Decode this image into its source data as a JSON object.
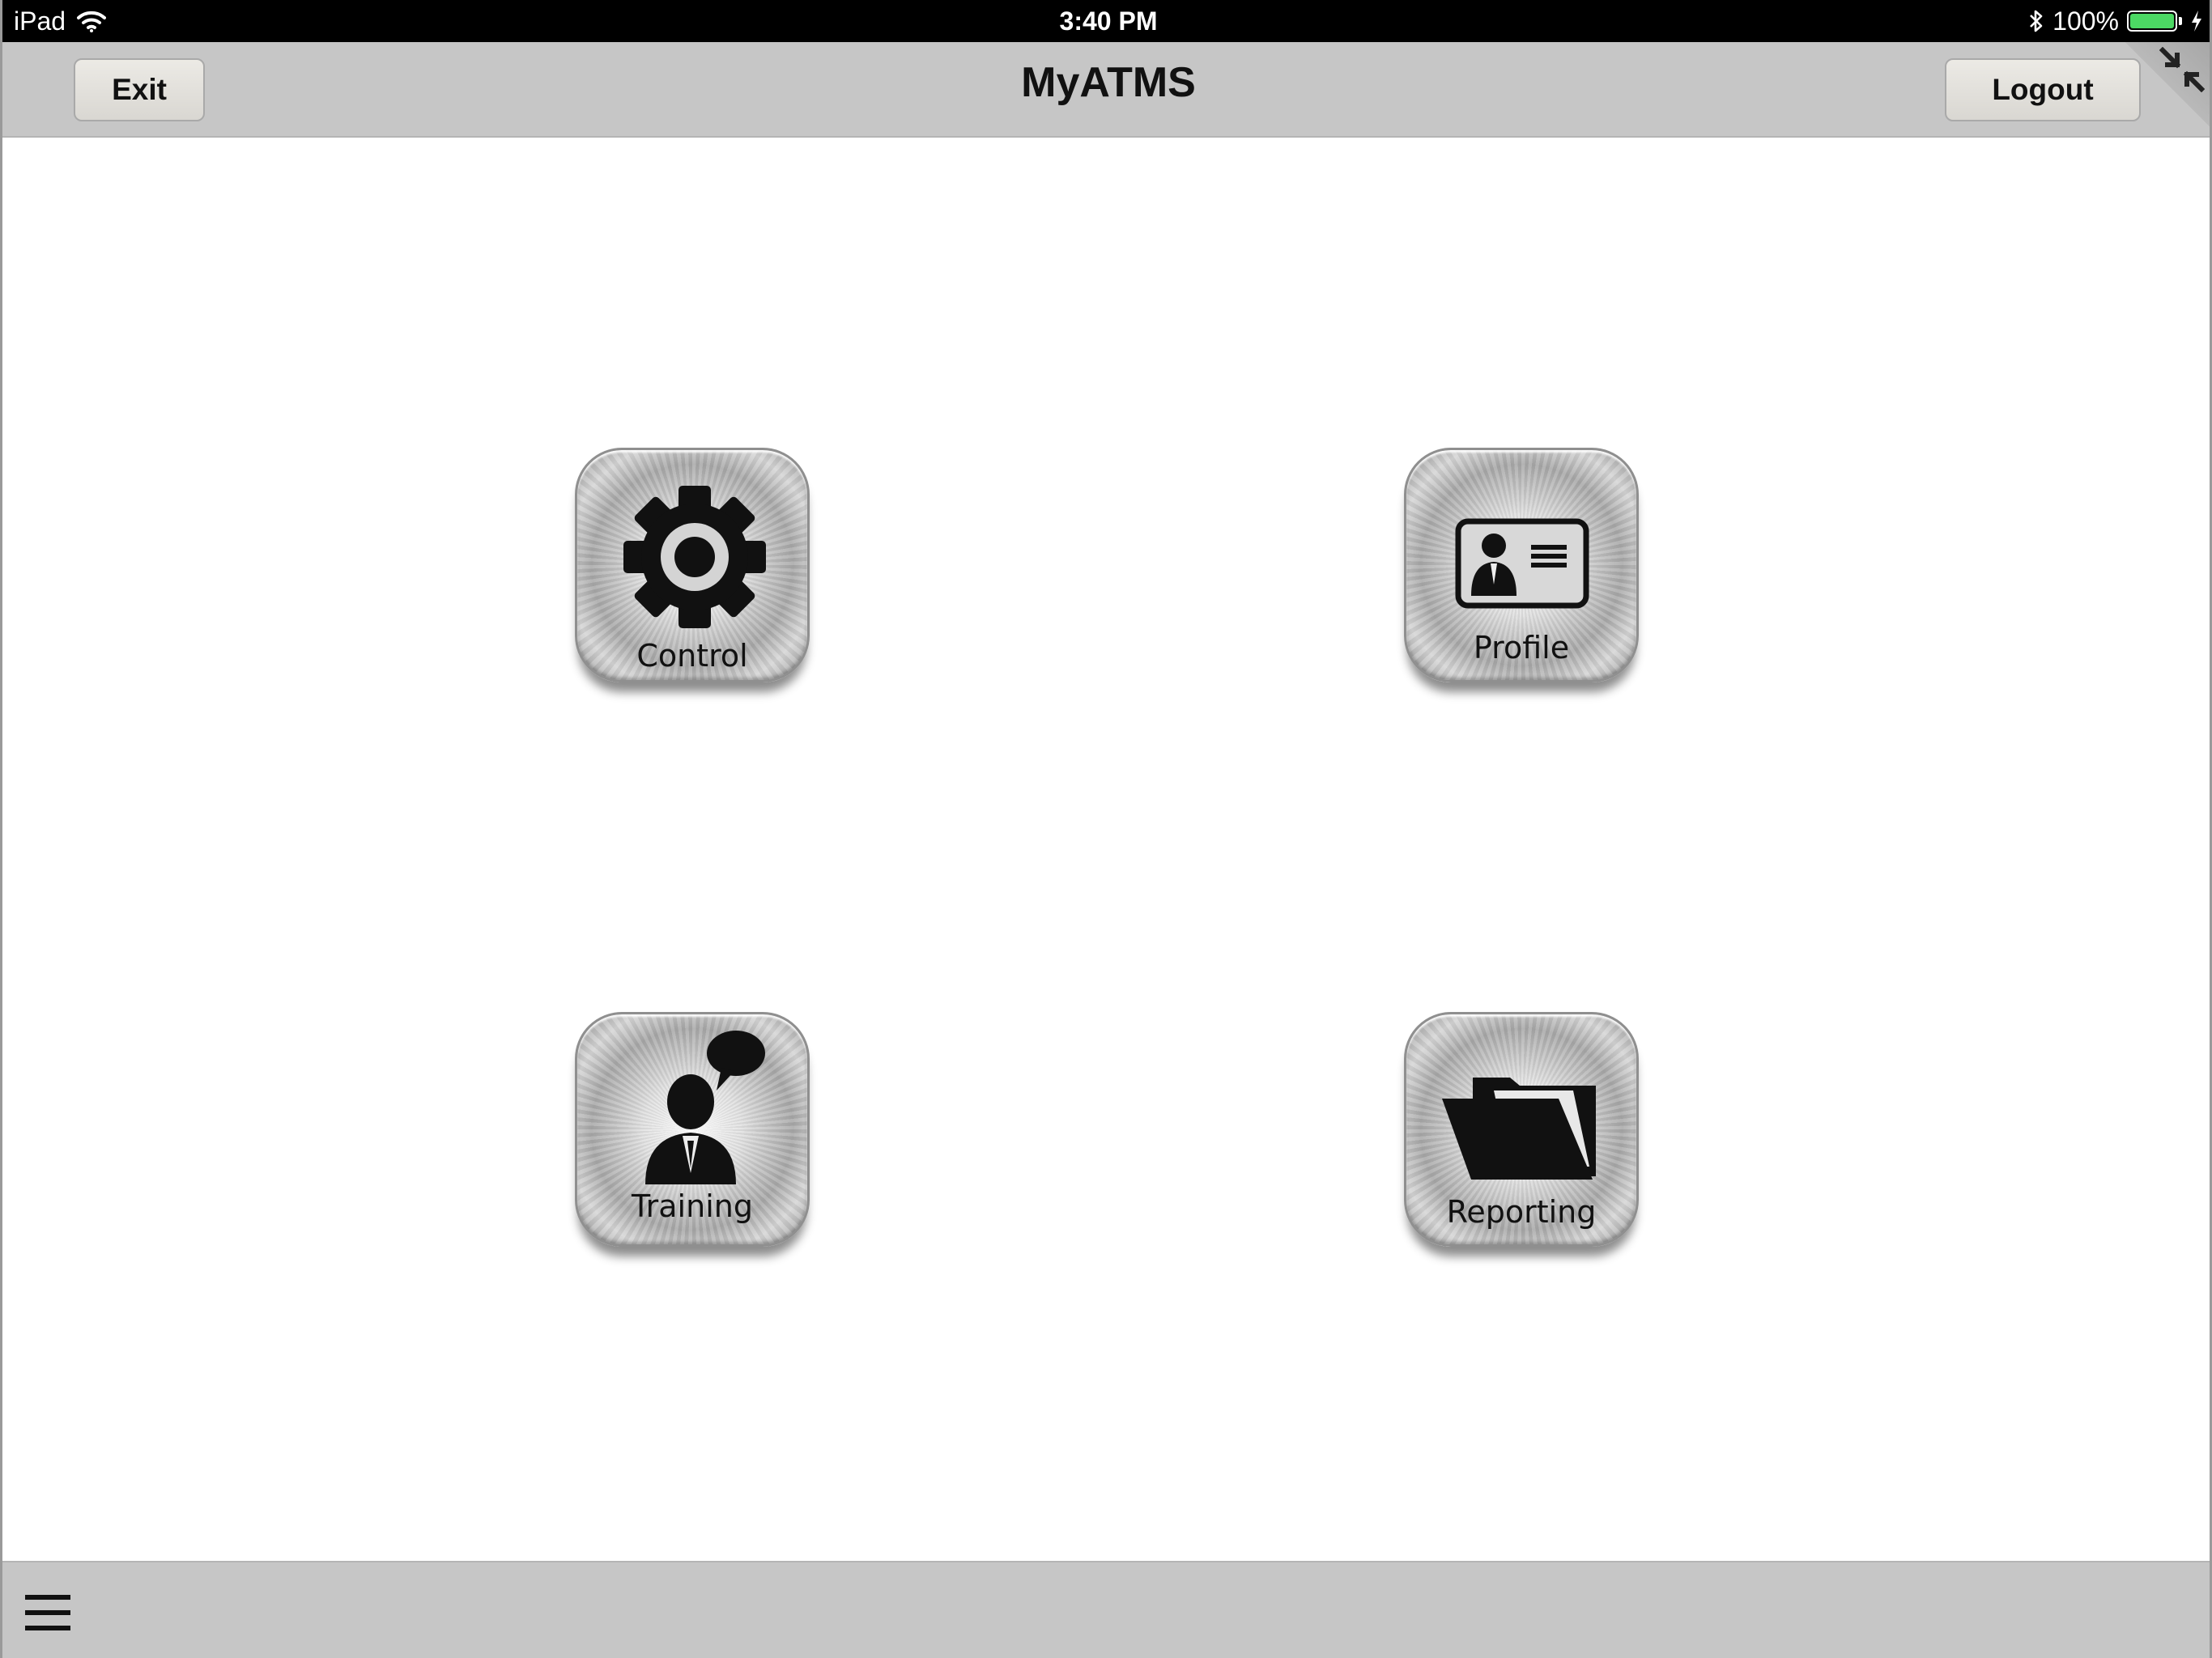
{
  "status_bar": {
    "device": "iPad",
    "time": "3:40 PM",
    "battery": "100%",
    "battery_level": 1.0,
    "icons": [
      "wifi-icon",
      "bluetooth-icon",
      "battery-icon",
      "charging-bolt-icon"
    ]
  },
  "nav": {
    "title": "MyATMS",
    "exit_label": "Exit",
    "logout_label": "Logout",
    "corner_icon": "collapse-arrows-icon"
  },
  "tiles": [
    {
      "label": "Control",
      "icon": "gear-icon"
    },
    {
      "label": "Profile",
      "icon": "id-card-icon"
    },
    {
      "label": "Training",
      "icon": "presenter-speech-icon"
    },
    {
      "label": "Reporting",
      "icon": "folder-icon"
    }
  ],
  "bottom_bar": {
    "menu_icon": "hamburger-menu-icon"
  },
  "colors": {
    "bar_gray": "#c6c6c6",
    "status_black": "#000000",
    "battery_green": "#4cd964"
  }
}
